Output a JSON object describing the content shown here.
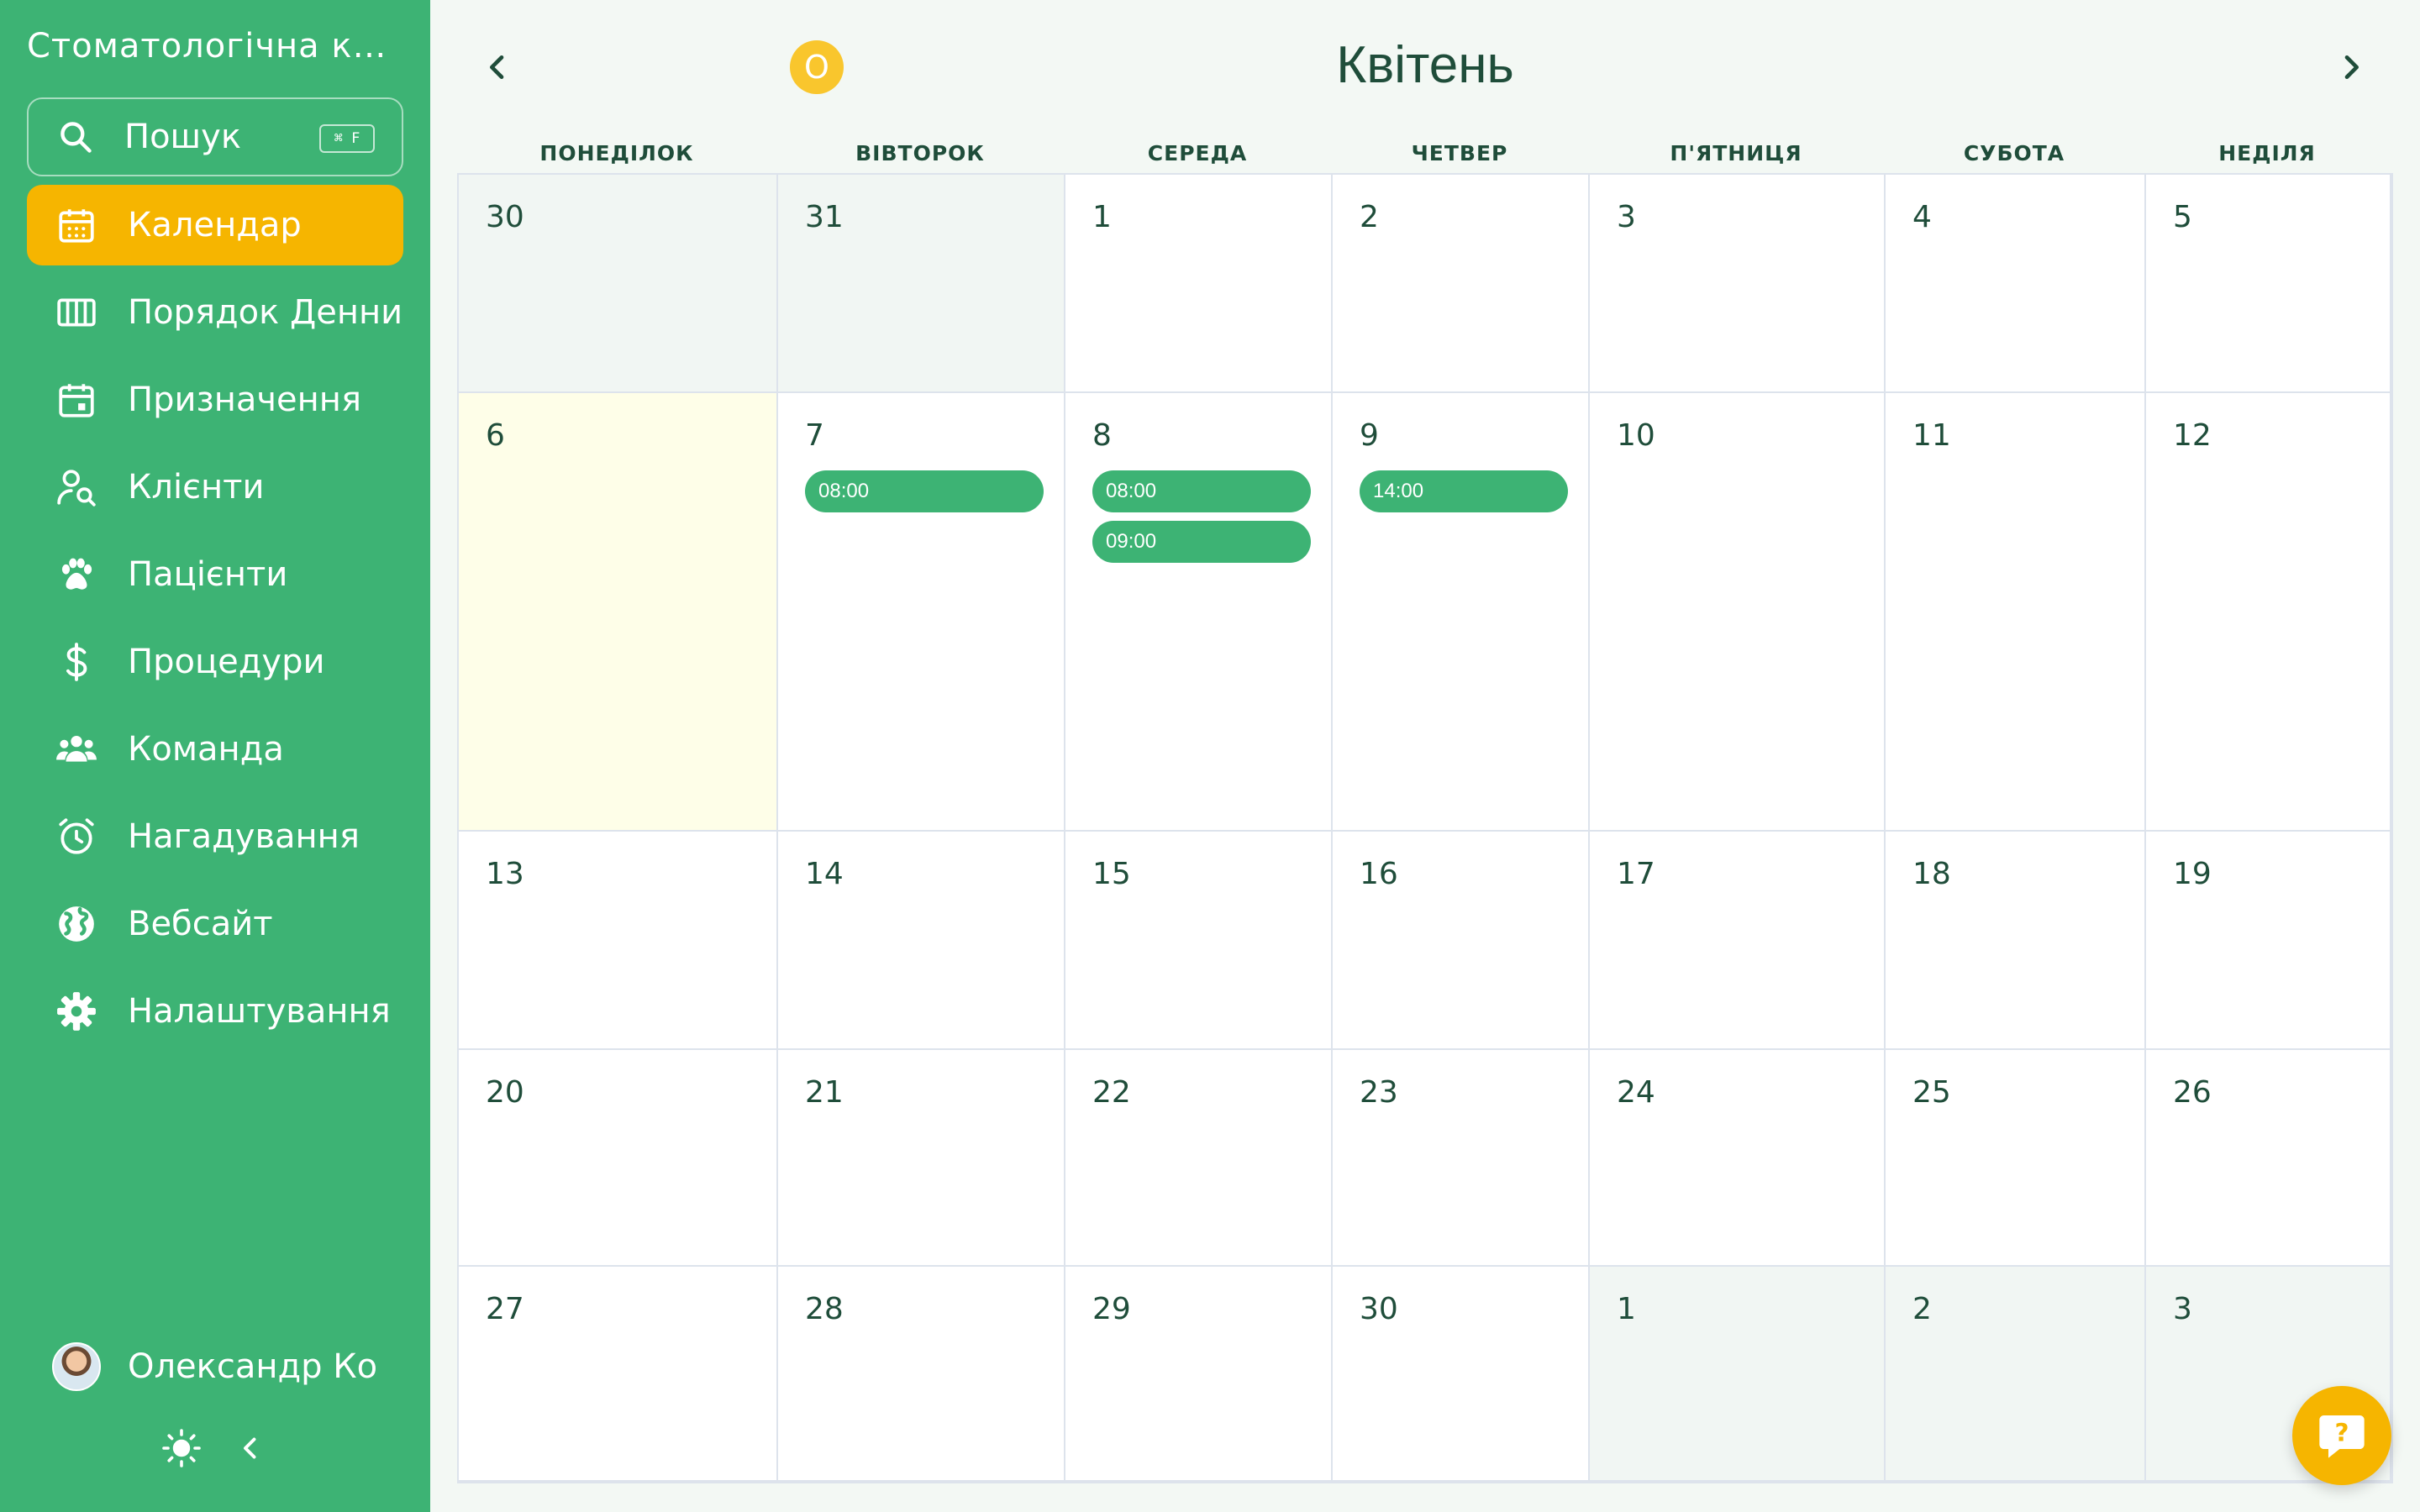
{
  "sidebar": {
    "clinic_name": "Стоматологічна клініка",
    "search": {
      "label": "Пошук",
      "shortcut": "⌘ F",
      "icon": "search-icon"
    },
    "items": [
      {
        "label": "Календар",
        "icon": "calendar-icon",
        "active": true
      },
      {
        "label": "Порядок Денний",
        "icon": "columns-icon",
        "active": false
      },
      {
        "label": "Призначення",
        "icon": "calendar-event-icon",
        "active": false
      },
      {
        "label": "Клієнти",
        "icon": "user-search-icon",
        "active": false
      },
      {
        "label": "Пацієнти",
        "icon": "paw-icon",
        "active": false
      },
      {
        "label": "Процедури",
        "icon": "dollar-icon",
        "active": false
      },
      {
        "label": "Команда",
        "icon": "team-icon",
        "active": false
      },
      {
        "label": "Нагадування",
        "icon": "alarm-icon",
        "active": false
      },
      {
        "label": "Вебсайт",
        "icon": "globe-icon",
        "active": false
      },
      {
        "label": "Налаштування",
        "icon": "gear-icon",
        "active": false
      }
    ],
    "user": {
      "name": "Олександр Коваленко"
    }
  },
  "calendar": {
    "month": "Квітень",
    "today_badge": "О",
    "weekdays": [
      "ПОНЕДІЛОК",
      "ВІВТОРОК",
      "СЕРЕДА",
      "ЧЕТВЕР",
      "П'ЯТНИЦЯ",
      "СУБОТА",
      "НЕДІЛЯ"
    ],
    "weeks": [
      [
        {
          "day": "30",
          "muted": true,
          "events": []
        },
        {
          "day": "31",
          "muted": true,
          "events": []
        },
        {
          "day": "1",
          "events": []
        },
        {
          "day": "2",
          "events": []
        },
        {
          "day": "3",
          "events": []
        },
        {
          "day": "4",
          "events": []
        },
        {
          "day": "5",
          "events": []
        }
      ],
      [
        {
          "day": "6",
          "today": true,
          "events": []
        },
        {
          "day": "7",
          "events": [
            "08:00"
          ]
        },
        {
          "day": "8",
          "events": [
            "08:00",
            "09:00"
          ]
        },
        {
          "day": "9",
          "events": [
            "14:00"
          ]
        },
        {
          "day": "10",
          "events": []
        },
        {
          "day": "11",
          "events": []
        },
        {
          "day": "12",
          "events": []
        }
      ],
      [
        {
          "day": "13",
          "events": []
        },
        {
          "day": "14",
          "events": []
        },
        {
          "day": "15",
          "events": []
        },
        {
          "day": "16",
          "events": []
        },
        {
          "day": "17",
          "events": []
        },
        {
          "day": "18",
          "events": []
        },
        {
          "day": "19",
          "events": []
        }
      ],
      [
        {
          "day": "20",
          "events": []
        },
        {
          "day": "21",
          "events": []
        },
        {
          "day": "22",
          "events": []
        },
        {
          "day": "23",
          "events": []
        },
        {
          "day": "24",
          "events": []
        },
        {
          "day": "25",
          "events": []
        },
        {
          "day": "26",
          "events": []
        }
      ],
      [
        {
          "day": "27",
          "events": []
        },
        {
          "day": "28",
          "events": []
        },
        {
          "day": "29",
          "events": []
        },
        {
          "day": "30",
          "events": []
        },
        {
          "day": "1",
          "muted": true,
          "events": []
        },
        {
          "day": "2",
          "muted": true,
          "events": []
        },
        {
          "day": "3",
          "muted": true,
          "events": []
        }
      ]
    ]
  },
  "colors": {
    "sidebar": "#3db374",
    "accent": "#f6b500",
    "event": "#3db374",
    "text": "#1f4d3a"
  }
}
